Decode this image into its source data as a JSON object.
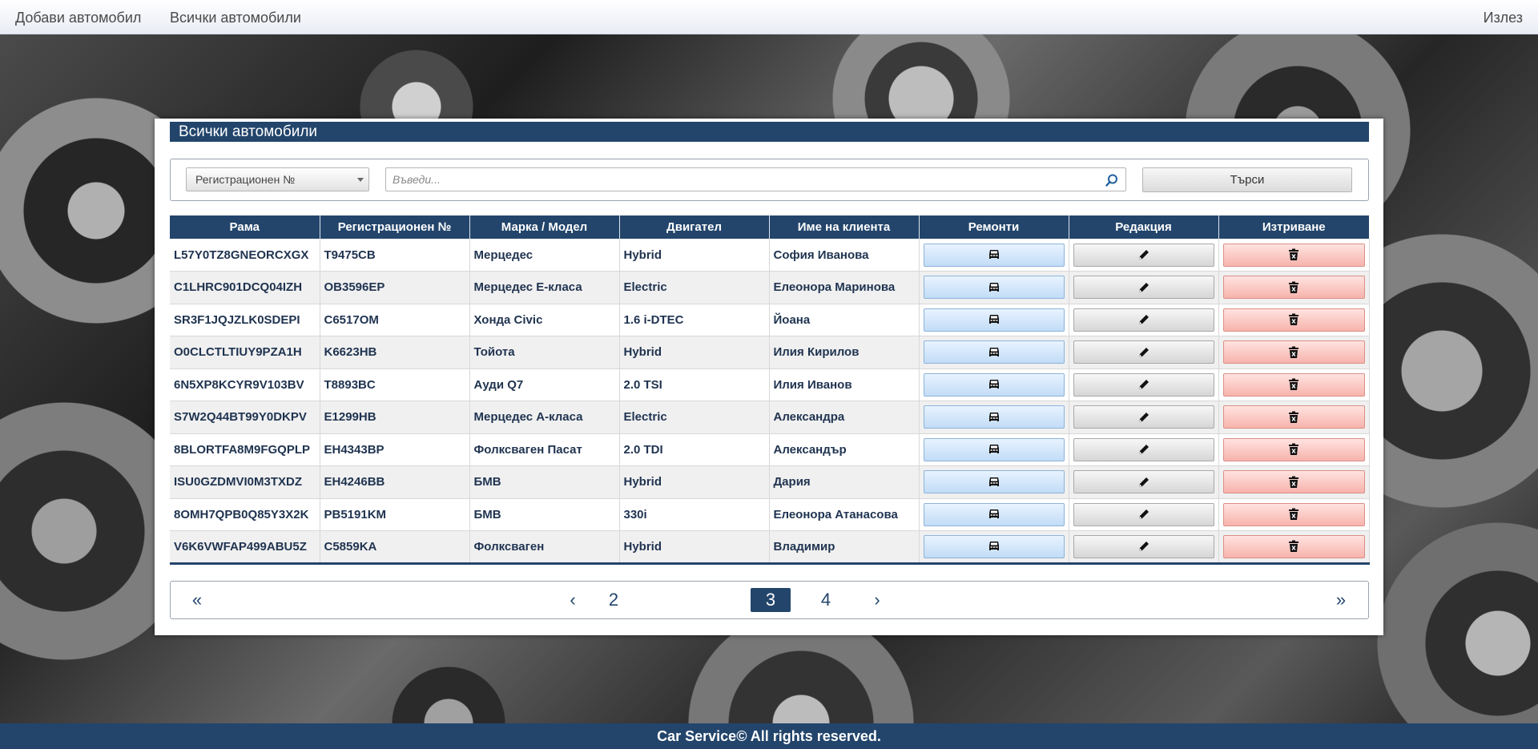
{
  "nav": {
    "add_car": "Добави автомобил",
    "all_cars": "Всички автомобили",
    "logout": "Излез"
  },
  "panel": {
    "title": "Всички автомобили"
  },
  "search": {
    "field_selected": "Регистрационен №",
    "placeholder": "Въведи...",
    "button": "Търси"
  },
  "table": {
    "headers": [
      "Рама",
      "Регистрационен №",
      "Марка / Модел",
      "Двигател",
      "Име на клиента",
      "Ремонти",
      "Редакция",
      "Изтриване"
    ],
    "rows": [
      {
        "vin": "L57Y0TZ8GNEORCXGX",
        "reg": "T9475CB",
        "model": "Мерцедес",
        "engine": "Hybrid",
        "client": "София Иванова"
      },
      {
        "vin": "C1LHRC901DCQ04IZH",
        "reg": "OB3596EP",
        "model": "Мерцедес Е-класа",
        "engine": "Electric",
        "client": "Елеонора Маринова"
      },
      {
        "vin": "SR3F1JQJZLK0SDEPI",
        "reg": "C6517OM",
        "model": "Хонда Civic",
        "engine": "1.6 i-DTEC",
        "client": "Йоана"
      },
      {
        "vin": "O0CLCTLTIUY9PZA1H",
        "reg": "K6623HB",
        "model": "Тойота",
        "engine": "Hybrid",
        "client": "Илия Кирилов"
      },
      {
        "vin": "6N5XP8KCYR9V103BV",
        "reg": "T8893BC",
        "model": "Ауди Q7",
        "engine": "2.0 TSI",
        "client": "Илия Иванов"
      },
      {
        "vin": "S7W2Q44BT99Y0DKPV",
        "reg": "E1299HB",
        "model": "Мерцедес А-класа",
        "engine": "Electric",
        "client": "Александра"
      },
      {
        "vin": "8BLORTFA8M9FGQPLP",
        "reg": "EH4343BP",
        "model": "Фолксваген Пасат",
        "engine": "2.0 TDI",
        "client": "Александър"
      },
      {
        "vin": "ISU0GZDMVI0M3TXDZ",
        "reg": "EH4246BB",
        "model": "БМВ",
        "engine": "Hybrid",
        "client": "Дария"
      },
      {
        "vin": "8OMH7QPB0Q85Y3X2K",
        "reg": "PB5191KM",
        "model": "БМВ",
        "engine": "330i",
        "client": "Елеонора Атанасова"
      },
      {
        "vin": "V6K6VWFAP499ABU5Z",
        "reg": "C5859KA",
        "model": "Фолксваген",
        "engine": "Hybrid",
        "client": "Владимир"
      }
    ]
  },
  "pager": {
    "first": "«",
    "prev": "‹",
    "pages": [
      "2",
      "3",
      "4"
    ],
    "current": "3",
    "next": "›",
    "last": "»"
  },
  "footer": {
    "text": "Car Service© All rights reserved."
  },
  "icons": {
    "repairs": "car-icon",
    "edit": "pencil-icon",
    "delete": "trash-icon",
    "search": "search-icon"
  },
  "colors": {
    "primary": "#23456b",
    "repair_button": "#c2dcf7",
    "edit_button": "#d6d6d6",
    "delete_button": "#f7b3ac"
  }
}
